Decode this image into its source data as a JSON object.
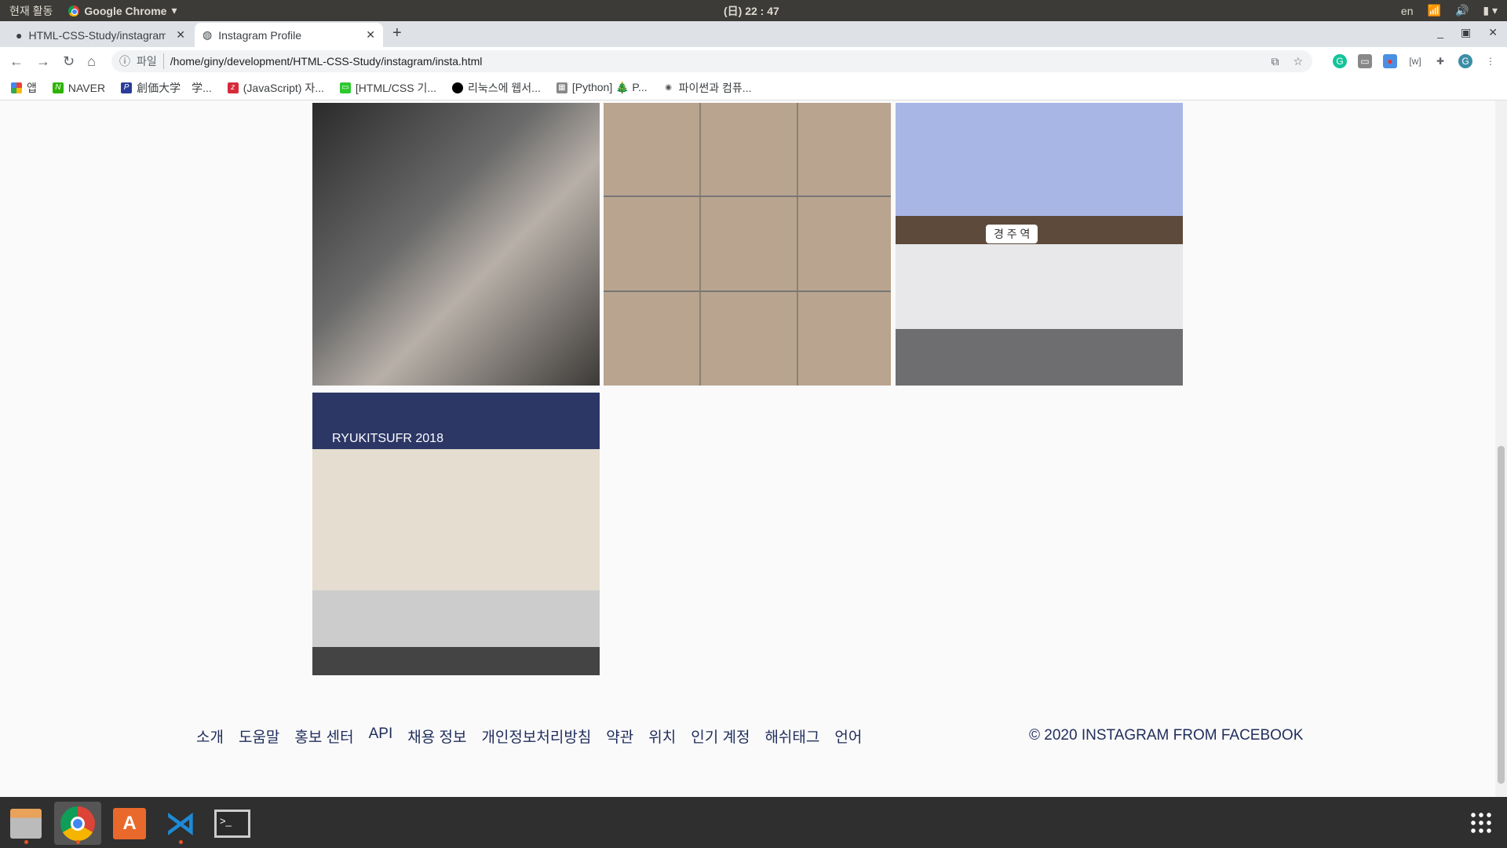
{
  "system": {
    "activities": "현재 활동",
    "app_name": "Google Chrome",
    "clock": "(日) 22 : 47",
    "lang": "en"
  },
  "tabs": [
    {
      "label": "HTML-CSS-Study/instagram"
    },
    {
      "label": "Instagram Profile"
    }
  ],
  "address": {
    "scheme": "파일",
    "url": "/home/giny/development/HTML-CSS-Study/instagram/insta.html",
    "avatar": "G"
  },
  "bookmarks": [
    {
      "label": "앱"
    },
    {
      "label": "NAVER"
    },
    {
      "label": "創価大学　学..."
    },
    {
      "label": "(JavaScript) 자..."
    },
    {
      "label": "[HTML/CSS 기..."
    },
    {
      "label": "리눅스에 웹서..."
    },
    {
      "label": "[Python] 🎄 P..."
    },
    {
      "label": "파이썬과 컴퓨..."
    }
  ],
  "photos": [
    {
      "alt": "friends mirror selfie"
    },
    {
      "alt": "group photo collage"
    },
    {
      "alt": "Gyeongju Station",
      "sign": "경 주 역"
    },
    {
      "alt": "festival booth",
      "caption": "RYUKITSUFR 2018"
    }
  ],
  "footer": {
    "links": [
      "소개",
      "도움말",
      "홍보 센터",
      "API",
      "채용 정보",
      "개인정보처리방침",
      "약관",
      "위치",
      "인기 계정",
      "해쉬태그",
      "언어"
    ],
    "copyright": "© 2020 INSTAGRAM FROM FACEBOOK"
  }
}
